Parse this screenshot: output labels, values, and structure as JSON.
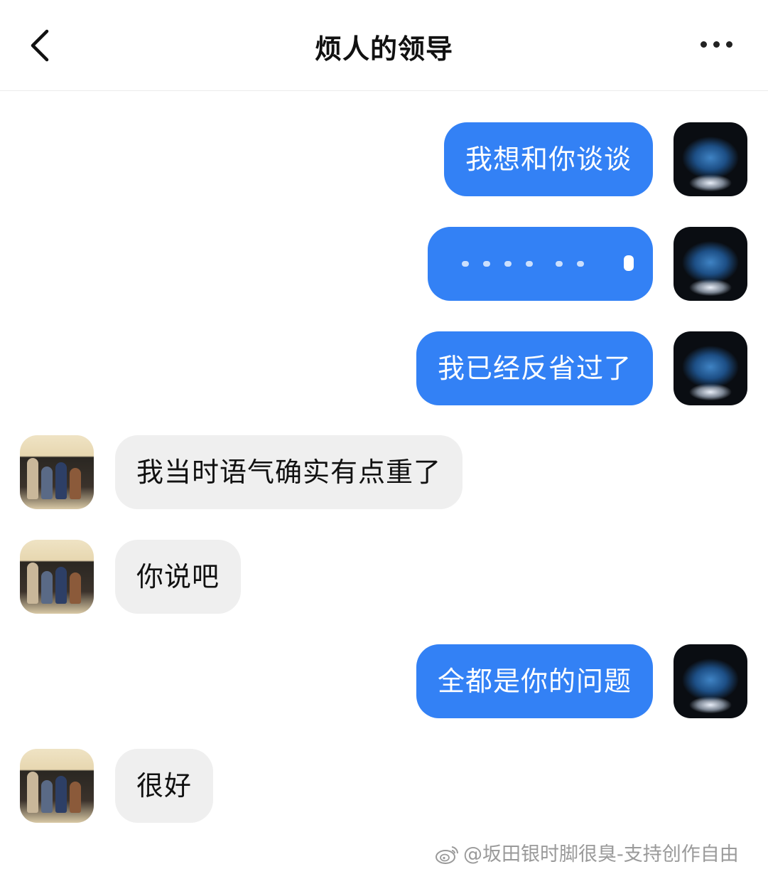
{
  "header": {
    "title": "烦人的领导"
  },
  "messages": [
    {
      "side": "me",
      "text": "我想和你谈谈"
    },
    {
      "side": "me",
      "text": ""
    },
    {
      "side": "me",
      "text": "我已经反省过了"
    },
    {
      "side": "them",
      "text": "我当时语气确实有点重了"
    },
    {
      "side": "them",
      "text": "你说吧"
    },
    {
      "side": "me",
      "text": "全都是你的问题"
    },
    {
      "side": "them",
      "text": "很好"
    }
  ],
  "watermark": {
    "text": "@坂田银时脚很臭-支持创作自由"
  },
  "colors": {
    "my_bubble": "#3381f5",
    "their_bubble": "#efefef"
  },
  "icons": {
    "back": "chevron-left-icon",
    "more": "more-horizontal-icon",
    "watermark": "weibo-logo-icon"
  }
}
